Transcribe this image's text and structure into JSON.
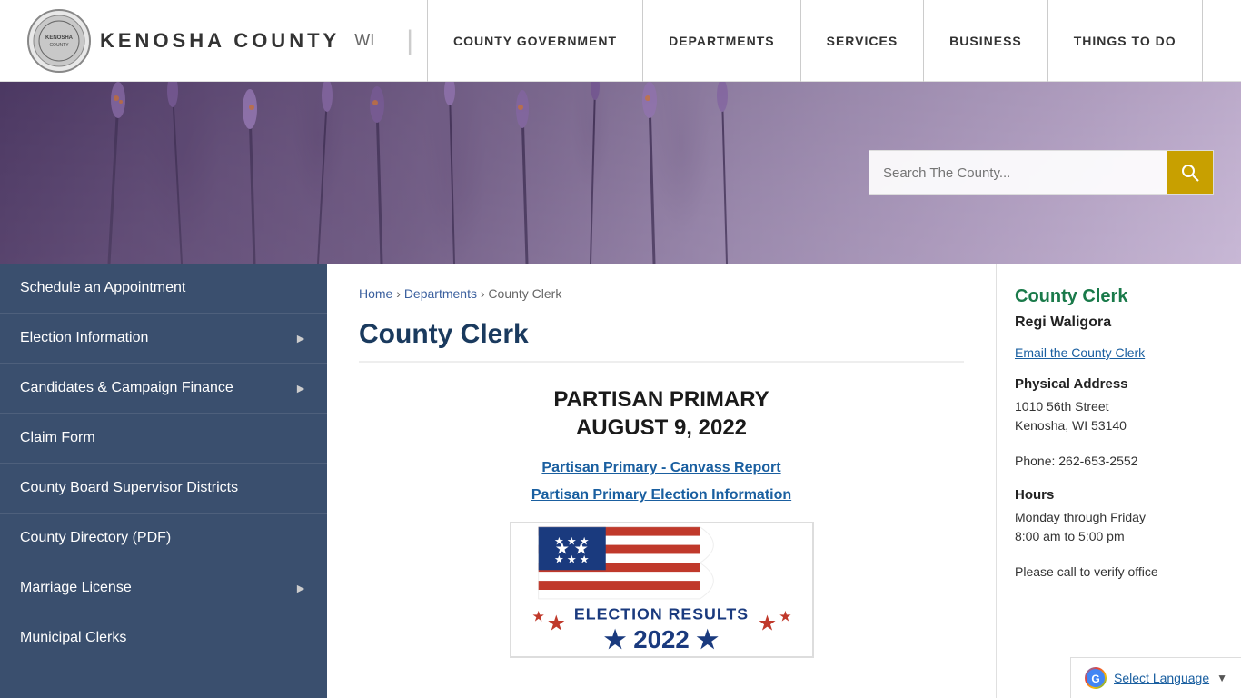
{
  "header": {
    "logo_text": "KENOSHA COUNTY",
    "logo_wi": "WI",
    "divider": "|",
    "nav_items": [
      {
        "label": "COUNTY GOVERNMENT",
        "id": "county-government"
      },
      {
        "label": "DEPARTMENTS",
        "id": "departments"
      },
      {
        "label": "SERVICES",
        "id": "services"
      },
      {
        "label": "BUSINESS",
        "id": "business"
      },
      {
        "label": "THINGS TO DO",
        "id": "things-to-do"
      }
    ]
  },
  "hero": {
    "search_placeholder": "Search The County..."
  },
  "sidebar": {
    "items": [
      {
        "label": "Schedule an Appointment",
        "has_arrow": false,
        "id": "schedule"
      },
      {
        "label": "Election Information",
        "has_arrow": true,
        "id": "election-info"
      },
      {
        "label": "Candidates & Campaign Finance",
        "has_arrow": true,
        "id": "candidates"
      },
      {
        "label": "Claim Form",
        "has_arrow": false,
        "id": "claim-form"
      },
      {
        "label": "County Board Supervisor Districts",
        "has_arrow": false,
        "id": "supervisor-districts"
      },
      {
        "label": "County Directory (PDF)",
        "has_arrow": false,
        "id": "county-directory"
      },
      {
        "label": "Marriage License",
        "has_arrow": true,
        "id": "marriage-license"
      },
      {
        "label": "Municipal Clerks",
        "has_arrow": false,
        "id": "municipal-clerks"
      }
    ]
  },
  "breadcrumb": {
    "home": "Home",
    "departments": "Departments",
    "separator": "›",
    "current": "County Clerk"
  },
  "main": {
    "page_title": "County Clerk",
    "primary_heading_line1": "PARTISAN PRIMARY",
    "primary_heading_line2": "AUGUST 9, 2022",
    "link1": "Partisan Primary - Canvass Report",
    "link2": "Partisan Primary Election Information"
  },
  "right_panel": {
    "title": "County Clerk",
    "name": "Regi Waligora",
    "email_link": "Email the County Clerk",
    "physical_address_title": "Physical Address",
    "address_line1": "1010 56th Street",
    "address_line2": "Kenosha, WI 53140",
    "phone": "Phone: 262-653-2552",
    "hours_title": "Hours",
    "hours_text": "Monday through Friday",
    "hours_time": "8:00 am to 5:00 pm",
    "please_call": "Please call to verify office"
  },
  "footer": {
    "select_language": "Select Language",
    "google_g": "G"
  }
}
